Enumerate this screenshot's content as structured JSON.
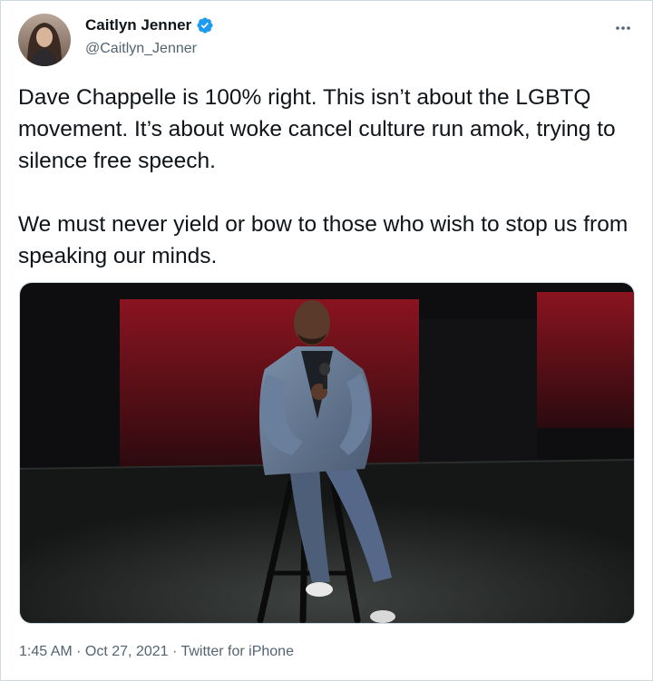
{
  "author": {
    "display_name": "Caitlyn Jenner",
    "handle": "@Caitlyn_Jenner",
    "verified": true,
    "avatar_icon": "profile-avatar"
  },
  "tweet": {
    "paragraphs": [
      "Dave Chappelle is 100% right. This isn’t about the LGBTQ movement. It’s about woke cancel culture run amok, trying to silence free speech.",
      "We must never yield or bow to those who wish to stop us from speaking our minds."
    ],
    "media_description_icon": "embedded-video-still",
    "timestamp": "1:45 AM · Oct 27, 2021 · Twitter for iPhone"
  },
  "colors": {
    "accent": "#1d9bf0",
    "text_primary": "#0f1419",
    "text_secondary": "#536471",
    "border": "#cfd9de"
  }
}
